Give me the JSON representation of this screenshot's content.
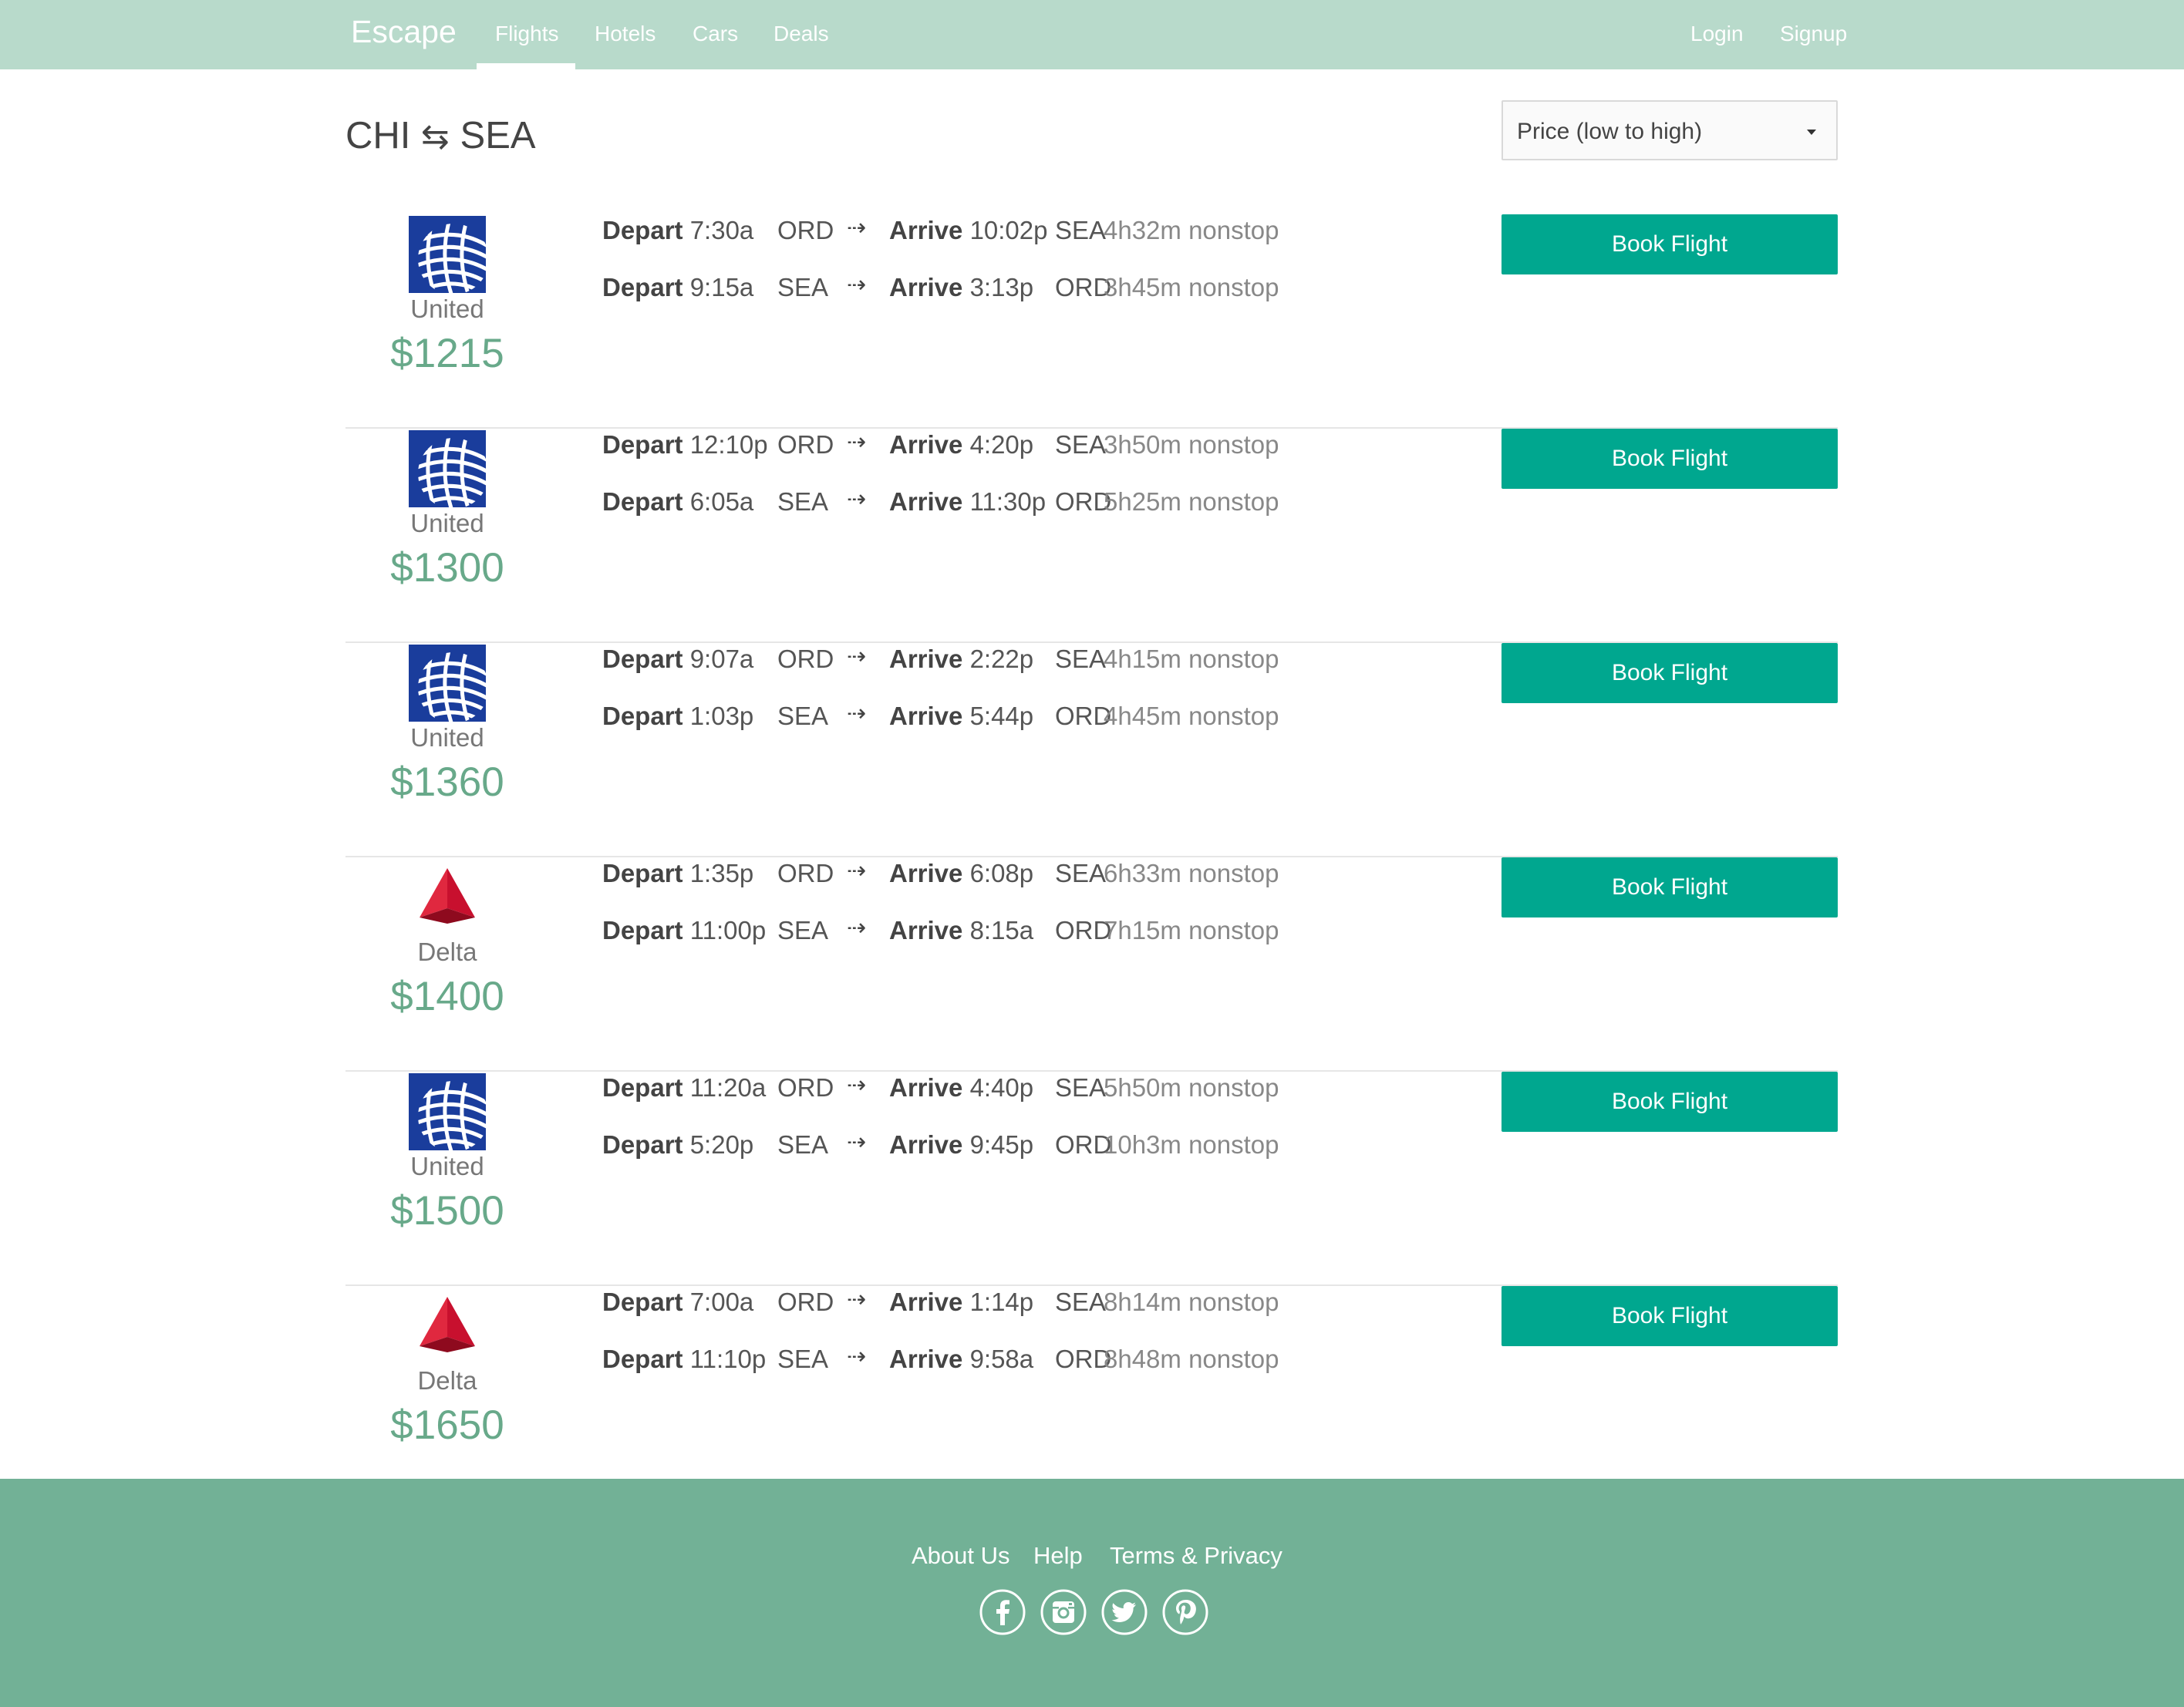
{
  "navbar": {
    "brand": "Escape",
    "links": [
      {
        "label": "Flights",
        "active": true
      },
      {
        "label": "Hotels"
      },
      {
        "label": "Cars"
      },
      {
        "label": "Deals"
      }
    ],
    "auth": {
      "login": "Login",
      "signup": "Signup"
    },
    "background_color": "#b8dacb"
  },
  "page": {
    "title_from": "CHI",
    "title_arrow": "⇆",
    "title_to": "SEA"
  },
  "sort": {
    "selected": "Price (low to high)"
  },
  "labels": {
    "depart": "Depart",
    "arrive": "Arrive",
    "arrow": "⇢",
    "book": "Book Flight"
  },
  "flights": [
    {
      "airline": "United",
      "logo": "united-globe-icon",
      "price": "$1215",
      "legs": [
        {
          "depart_time": "7:30a",
          "from": "ORD",
          "arrive_time": "10:02p",
          "to": "SEA",
          "duration": "4h32m nonstop"
        },
        {
          "depart_time": "9:15a",
          "from": "SEA",
          "arrive_time": "3:13p",
          "to": "ORD",
          "duration": "3h45m nonstop"
        }
      ]
    },
    {
      "airline": "United",
      "logo": "united-globe-icon",
      "price": "$1300",
      "legs": [
        {
          "depart_time": "12:10p",
          "from": "ORD",
          "arrive_time": "4:20p",
          "to": "SEA",
          "duration": "3h50m nonstop"
        },
        {
          "depart_time": "6:05a",
          "from": "SEA",
          "arrive_time": "11:30p",
          "to": "ORD",
          "duration": "5h25m nonstop"
        }
      ]
    },
    {
      "airline": "United",
      "logo": "united-globe-icon",
      "price": "$1360",
      "legs": [
        {
          "depart_time": "9:07a",
          "from": "ORD",
          "arrive_time": "2:22p",
          "to": "SEA",
          "duration": "4h15m nonstop"
        },
        {
          "depart_time": "1:03p",
          "from": "SEA",
          "arrive_time": "5:44p",
          "to": "ORD",
          "duration": "4h45m nonstop"
        }
      ]
    },
    {
      "airline": "Delta",
      "logo": "delta-widget-icon",
      "price": "$1400",
      "legs": [
        {
          "depart_time": "1:35p",
          "from": "ORD",
          "arrive_time": "6:08p",
          "to": "SEA",
          "duration": "6h33m nonstop"
        },
        {
          "depart_time": "11:00p",
          "from": "SEA",
          "arrive_time": "8:15a",
          "to": "ORD",
          "duration": "7h15m nonstop"
        }
      ]
    },
    {
      "airline": "United",
      "logo": "united-globe-icon",
      "price": "$1500",
      "legs": [
        {
          "depart_time": "11:20a",
          "from": "ORD",
          "arrive_time": "4:40p",
          "to": "SEA",
          "duration": "5h50m nonstop"
        },
        {
          "depart_time": "5:20p",
          "from": "SEA",
          "arrive_time": "9:45p",
          "to": "ORD",
          "duration": "10h3m nonstop"
        }
      ]
    },
    {
      "airline": "Delta",
      "logo": "delta-widget-icon",
      "price": "$1650",
      "legs": [
        {
          "depart_time": "7:00a",
          "from": "ORD",
          "arrive_time": "1:14p",
          "to": "SEA",
          "duration": "8h14m nonstop"
        },
        {
          "depart_time": "11:10p",
          "from": "SEA",
          "arrive_time": "9:58a",
          "to": "ORD",
          "duration": "8h48m nonstop"
        }
      ]
    }
  ],
  "footer": {
    "links": [
      "About Us",
      "Help",
      "Terms & Privacy"
    ],
    "social": [
      "facebook-icon",
      "instagram-icon",
      "twitter-icon",
      "pinterest-icon"
    ],
    "background_color": "#72b196"
  },
  "colors": {
    "accent": "#00a78f",
    "price": "#68a98a",
    "united_blue": "#1a3d9c",
    "delta_red": "#c8102e"
  }
}
